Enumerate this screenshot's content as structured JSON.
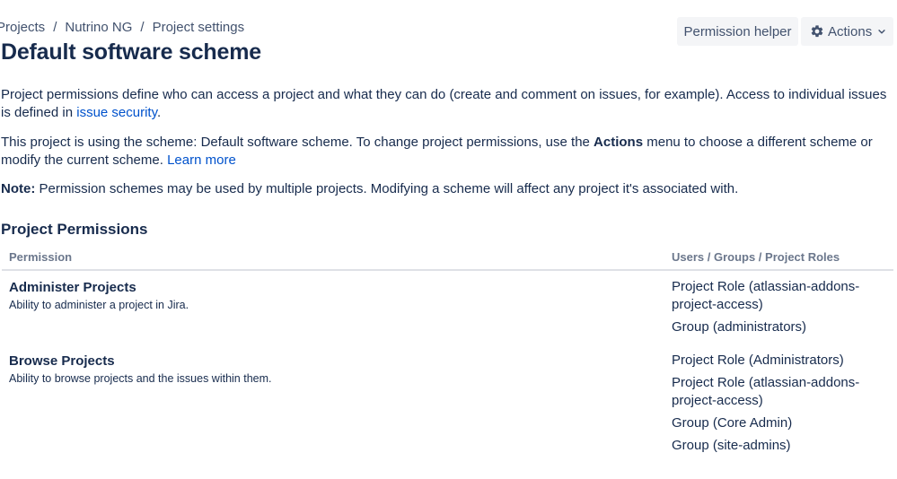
{
  "breadcrumb": {
    "items": [
      "Projects",
      "Nutrino NG",
      "Project settings"
    ],
    "separator": "/"
  },
  "page_title": "Default software scheme",
  "header_buttons": {
    "permission_helper": "Permission helper",
    "actions": "Actions",
    "actions_icon": "gear-icon",
    "actions_chevron_icon": "chevron-down-icon"
  },
  "intro": {
    "p1_text": "Project permissions define who can access a project and what they can do (create and comment on issues, for example). Access to individual issues is defined in ",
    "p1_link": "issue security",
    "p1_end": ".",
    "p2_text": "This project is using the scheme: Default software scheme. To change project permissions, use the ",
    "p2_bold": "Actions",
    "p2_rest": " menu to choose a different scheme or modify the current scheme. ",
    "p2_link": "Learn more",
    "note_label": "Note:",
    "note_text": " Permission schemes may be used by multiple projects. Modifying a scheme will affect any project it's associated with."
  },
  "section_title": "Project Permissions",
  "table": {
    "columns": [
      "Permission",
      "Users / Groups / Project Roles"
    ],
    "rows": [
      {
        "name": "Administer Projects",
        "description": "Ability to administer a project in Jira.",
        "holders": [
          "Project Role (atlassian-addons-project-access)",
          "Group (administrators)"
        ]
      },
      {
        "name": "Browse Projects",
        "description": "Ability to browse projects and the issues within them.",
        "holders": [
          "Project Role (Administrators)",
          "Project Role (atlassian-addons-project-access)",
          "Group (Core Admin)",
          "Group (site-admins)"
        ]
      }
    ]
  },
  "colors": {
    "link": "#0052cc",
    "text": "#172b4d",
    "muted": "#6b778c",
    "button_bg": "#f4f5f7"
  }
}
